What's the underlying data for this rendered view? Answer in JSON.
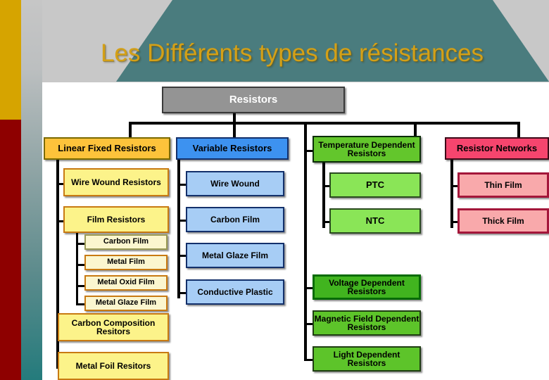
{
  "slide": {
    "title": "Les Différents types de résistances",
    "title_color": "#d4a017",
    "accent_gold": "#d6a400",
    "accent_red": "#8e0000",
    "accent_teal": "#4a7c7e"
  },
  "diagram": {
    "root": {
      "label": "Resistors",
      "color": "#949494"
    },
    "branches": [
      {
        "label": "Linear Fixed Resistors",
        "color": "#fdc33b",
        "children": [
          {
            "label": "Wire Wound Resistors"
          },
          {
            "label": "Film Resistors",
            "children": [
              {
                "label": "Carbon Film"
              },
              {
                "label": "Metal Film"
              },
              {
                "label": "Metal Oxid Film"
              },
              {
                "label": "Metal Glaze Film"
              }
            ]
          },
          {
            "label": "Carbon Composition Resitors"
          },
          {
            "label": "Metal Foil Resitors"
          }
        ]
      },
      {
        "label": "Variable Resistors",
        "color": "#3d92f0",
        "children": [
          {
            "label": "Wire Wound"
          },
          {
            "label": "Carbon Film"
          },
          {
            "label": "Metal Glaze Film"
          },
          {
            "label": "Conductive Plastic"
          }
        ]
      },
      {
        "label": "Temperature Dependent Resistors",
        "color": "#63c62c",
        "children": [
          {
            "label": "PTC"
          },
          {
            "label": "NTC"
          }
        ]
      },
      {
        "label": "Resistor Networks",
        "color": "#f6456e",
        "children": [
          {
            "label": "Thin Film"
          },
          {
            "label": "Thick Film"
          }
        ]
      }
    ],
    "extra_nodes": [
      {
        "label": "Voltage Dependent Resistors",
        "color": "#41b41f"
      },
      {
        "label": "Magnetic Field Dependent Resistors",
        "color": "#5dc42a"
      },
      {
        "label": "Light Dependent Resistors",
        "color": "#5dc42a"
      }
    ]
  }
}
